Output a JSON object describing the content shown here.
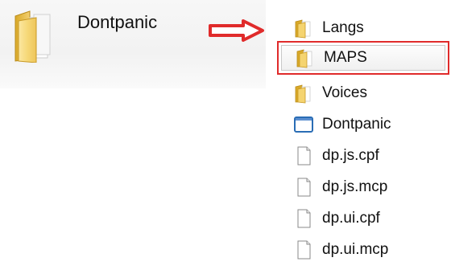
{
  "parent": {
    "name": "Dontpanic",
    "icon": "folder-icon"
  },
  "arrow": {
    "icon": "arrow-right-icon",
    "color": "#e02b2b"
  },
  "files": [
    {
      "name": "Langs",
      "type": "folder",
      "icon": "folder-icon",
      "selected": false
    },
    {
      "name": "MAPS",
      "type": "folder",
      "icon": "folder-icon",
      "selected": true
    },
    {
      "name": "Voices",
      "type": "folder",
      "icon": "folder-icon",
      "selected": false
    },
    {
      "name": "Dontpanic",
      "type": "application",
      "icon": "application-window-icon",
      "selected": false
    },
    {
      "name": "dp.js.cpf",
      "type": "file",
      "icon": "blank-file-icon",
      "selected": false
    },
    {
      "name": "dp.js.mcp",
      "type": "file",
      "icon": "blank-file-icon",
      "selected": false
    },
    {
      "name": "dp.ui.cpf",
      "type": "file",
      "icon": "blank-file-icon",
      "selected": false
    },
    {
      "name": "dp.ui.mcp",
      "type": "file",
      "icon": "blank-file-icon",
      "selected": false
    }
  ],
  "colors": {
    "highlight_border": "#e02b2b",
    "folder_yellow": "#f0c84a",
    "app_blue": "#2a6db5"
  }
}
